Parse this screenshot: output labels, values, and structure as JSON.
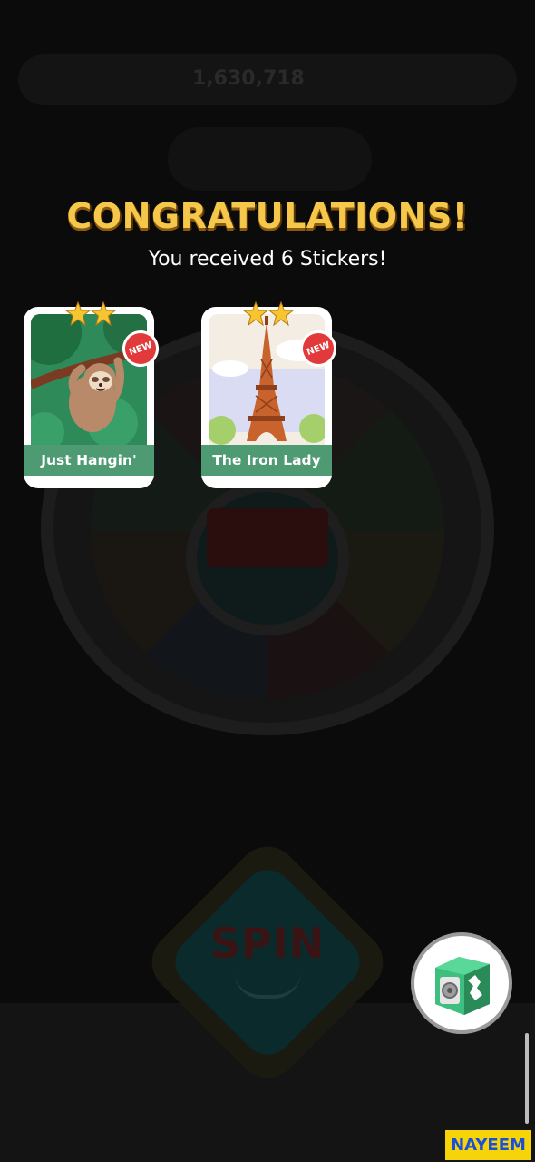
{
  "background": {
    "cash": "1,630,718",
    "spin_label": "SPIN"
  },
  "overlay": {
    "title": "CONGRATULATIONS!",
    "subtitle": "You received 6 Stickers!"
  },
  "stickers": [
    {
      "name": "Just Hangin'",
      "stars": 2,
      "badge": "NEW",
      "art": "sloth-on-branch"
    },
    {
      "name": "The Iron Lady",
      "stars": 2,
      "badge": "NEW",
      "art": "eiffel-tower"
    }
  ],
  "vault_button": {
    "icon": "vault-safe-icon"
  },
  "watermark": "NAYEEM",
  "colors": {
    "title": "#f5c84b",
    "label_band": "#4e9a72",
    "new_badge": "#e23a3a",
    "vault_green": "#3fbf7f"
  }
}
